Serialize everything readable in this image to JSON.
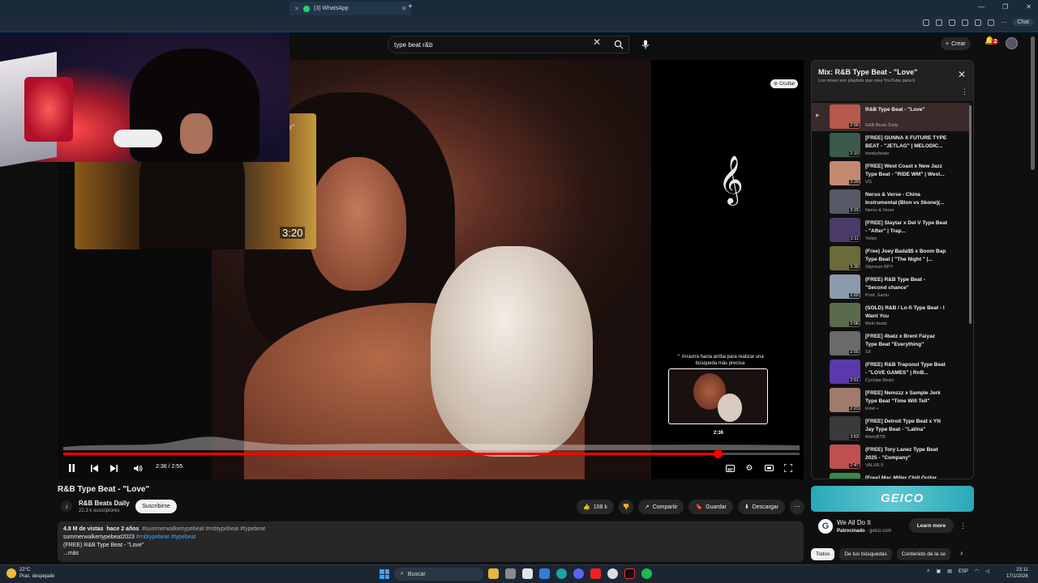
{
  "browser": {
    "tabs": [
      {
        "label": ""
      },
      {
        "label": "(3) WhatsApp"
      }
    ],
    "new_tab": "+",
    "window_controls": [
      "—",
      "❐",
      "✕"
    ],
    "chat_label": "Chat"
  },
  "header": {
    "search_value": "type beat r&b",
    "create_label": "Crear",
    "notification_count": "2"
  },
  "player": {
    "hide_label": "Ocultar",
    "drag_hint": "⌃ Arrastra hacia arriba para realizar una búsqueda más precisa",
    "preview_time": "2:36",
    "current_time": "2:36",
    "duration": "2:55",
    "time_display": "2:36 / 2:55",
    "progress": 0.889,
    "floating_time": "3:20",
    "floating_title_fragment": "e\""
  },
  "video": {
    "title": "R&B Type Beat - \"Love\"",
    "channel": "R&B Beats Daily",
    "subscribers": "22.3 k suscriptores",
    "subscribe_label": "Suscribirse",
    "likes": "108 k",
    "share_label": "Compartir",
    "save_label": "Guardar",
    "download_label": "Descargar"
  },
  "description": {
    "views": "4.8 M de vistas",
    "age": "hace 2 años",
    "hashtags_line1": "#summerwalkertypebeat #rnbtypebeat #typebeat",
    "tags_line2_a": "summerwalkertypebeat2023",
    "tags_line2_b": "#rnbtypebeat #typebeat",
    "line3": "(FREE) R&B Type Beat - \"Love\"",
    "more": "...más"
  },
  "playlist": {
    "title": "Mix: R&B Type Beat - \"Love\"",
    "subtitle": "Los mixes son playlists que crea YouTube para ti",
    "items": [
      {
        "title": "R&B Type Beat - \"Love\"",
        "channel": "R&B Beats Daily",
        "duration": "2:56",
        "color": "#b55a4a"
      },
      {
        "title": "[FREE] GUNNA X FUTURE TYPE BEAT - \"JETLAG\" | MELODIC...",
        "channel": "theskybeats",
        "duration": "2:19",
        "color": "#3a5a4a"
      },
      {
        "title": "[FREE] West Coast x New Jazz Type Beat - \"RIDE WM\" | West...",
        "channel": "VG",
        "duration": "2:20",
        "color": "#c48a70"
      },
      {
        "title": "Nerso & Verse - China Instrumental (Blon vs Skone)(...",
        "channel": "Nerso & Verse",
        "duration": "3:15",
        "color": "#555a66"
      },
      {
        "title": "[FREE] Slaytar x Del V Type Beat - \"After\" | Trap...",
        "channel": "Yelkin",
        "duration": "2:11",
        "color": "#4a3a6a"
      },
      {
        "title": "(Free) Joey Bada$$ x Boom Bap Type Beat | \"The Night \" |...",
        "channel": "Skyreum BPY",
        "duration": "3:39",
        "color": "#6a6a3a"
      },
      {
        "title": "(FREE) R&B Type Beat - \"Second chance\"",
        "channel": "Prod. Santu",
        "duration": "2:02",
        "color": "#8a9aaa"
      },
      {
        "title": "(SOLD) R&B / Lo-fi Type Beat - I Want You",
        "channel": "Melo beatz",
        "duration": "2:06",
        "color": "#5a6a4a"
      },
      {
        "title": "[FREE] 4batz x Brent Faiyaz Type Beat \"Everything\"",
        "channel": "SX",
        "duration": "2:55",
        "color": "#6a6a6a"
      },
      {
        "title": "(FREE) R&B Trapsoul Type Beat - \"LOVE GAMES\" | RnB...",
        "channel": "Cyclope Beatz",
        "duration": "2:51",
        "color": "#5a3aaa"
      },
      {
        "title": "[FREE] Nemzzz x Sample Jerk Type Beat \"Time Will Tell\"",
        "channel": "toriel +",
        "duration": "2:23",
        "color": "#a07a6a"
      },
      {
        "title": "[FREE] Detroit Type Beat x YN Jay Type Beat - \"Latina\"",
        "channel": "MarryBTB",
        "duration": "3:53",
        "color": "#3a3a3a"
      },
      {
        "title": "(FREE) Tory Lanez Type Beat 2025 - \"Company\"",
        "channel": "VALXR II",
        "duration": "2:47",
        "color": "#c05050"
      },
      {
        "title": "[Free] Mac Miller Chill Guitar",
        "channel": "",
        "duration": "",
        "color": "#3a8a4a"
      }
    ]
  },
  "ad": {
    "banner_brand": "GEICO",
    "title": "We All Do It",
    "sponsored": "Patrocinado",
    "domain": "geico.com",
    "cta": "Learn more"
  },
  "chips": [
    "Todos",
    "De tus búsquedas",
    "Contenido de la se"
  ],
  "taskbar": {
    "temp": "22°C",
    "weather_desc": "Prac. despejado",
    "search_label": "Buscar",
    "lang": "ESP",
    "time": "23:11",
    "date": "17/1/2026"
  },
  "colors": {
    "accent_red": "#ff0000",
    "bg": "#0f0f0f",
    "link_blue": "#3ea6ff"
  }
}
